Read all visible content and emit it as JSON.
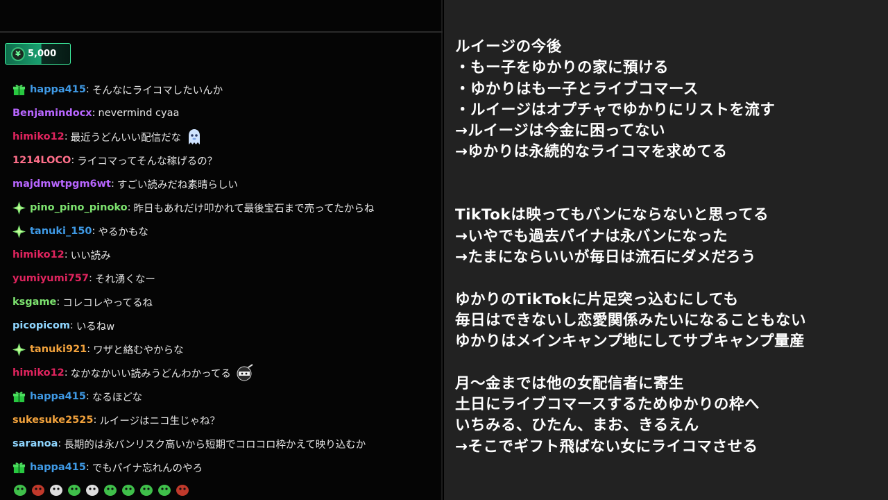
{
  "coins": {
    "amount": "5,000",
    "icon": "coin-icon",
    "accent": "#3ef0a0"
  },
  "chat": [
    {
      "badge": "gift",
      "user": "happa415",
      "color": "#3f9ae6",
      "text": "そんなにライコマしたいんか"
    },
    {
      "badge": "",
      "user": "Benjamindocx",
      "color": "#b866ff",
      "text": "nevermind cyaa"
    },
    {
      "badge": "",
      "user": "himiko12",
      "color": "#e0245e",
      "text": "最近うどんいい配信だな",
      "emote": "ghost-emote"
    },
    {
      "badge": "",
      "user": "1214LOCO",
      "color": "#ff6f8a",
      "text": "ライコマってそんな稼げるの？"
    },
    {
      "badge": "",
      "user": "majdmwtpgm6wt",
      "color": "#b866ff",
      "text": "すごい読みだね素晴らしい"
    },
    {
      "badge": "star",
      "user": "pino_pino_pinoko",
      "color": "#7de36f",
      "text": "昨日もあれだけ叩かれて最後宝石まで売ってたからね"
    },
    {
      "badge": "star",
      "user": "tanuki_150",
      "color": "#3f9ae6",
      "text": "やるかもな"
    },
    {
      "badge": "",
      "user": "himiko12",
      "color": "#e0245e",
      "text": "いい読み"
    },
    {
      "badge": "",
      "user": "yumiyumi757",
      "color": "#e0245e",
      "text": "それ湧くなー"
    },
    {
      "badge": "",
      "user": "ksgame",
      "color": "#7de36f",
      "text": "コレコレやってるね"
    },
    {
      "badge": "",
      "user": "picopicom",
      "color": "#8fd6ff",
      "text": "いるねw"
    },
    {
      "badge": "star",
      "user": "tanuki921",
      "color": "#f2a23c",
      "text": "ワザと絡むやからな"
    },
    {
      "badge": "",
      "user": "himiko12",
      "color": "#e0245e",
      "text": "なかなかいい読みうどんわかってる",
      "emote": "ninja-emote"
    },
    {
      "badge": "gift",
      "user": "happa415",
      "color": "#3f9ae6",
      "text": "なるほどな"
    },
    {
      "badge": "",
      "user": "sukesuke2525",
      "color": "#f2a23c",
      "text": "ルイージはニコ生じゃね？"
    },
    {
      "badge": "",
      "user": "saranoa",
      "color": "#8fd6ff",
      "text": "長期的は永バンリスク高いから短期でコロコロ枠かえて映り込むか"
    },
    {
      "badge": "gift",
      "user": "happa415",
      "color": "#3f9ae6",
      "text": "でもパイナ忘れんのやろ"
    }
  ],
  "emote_bar": [
    "frog-emote",
    "box-emote",
    "skull-emote",
    "frog-face-emote",
    "frog-hat-emote",
    "frog-smile-emote",
    "frog-blob-emote",
    "frog-small-emote",
    "frog-wink-emote",
    "frog-red-emote"
  ],
  "notes": [
    "ルイージの今後",
    "・もー子をゆかりの家に預ける",
    "・ゆかりはもー子とライブコマース",
    "・ルイージはオプチャでゆかりにリストを流す",
    "→ルイージは今金に困ってない",
    "→ゆかりは永続的なライコマを求めてる",
    "",
    "",
    "TikTokは映ってもバンにならないと思ってる",
    "→いやでも過去パイナは永バンになった",
    "→たまにならいいが毎日は流石にダメだろう",
    "",
    "ゆかりのTikTokに片足突っ込むにしても",
    "毎日はできないし恋愛関係みたいになることもない",
    "ゆかりはメインキャンプ地にしてサブキャンプ量産",
    "",
    "月〜金までは他の女配信者に寄生",
    "土日にライブコマースするためゆかりの枠へ",
    "いちみる、ひたん、まお、きるえん",
    "→そこでギフト飛ばない女にライコマさせる"
  ]
}
